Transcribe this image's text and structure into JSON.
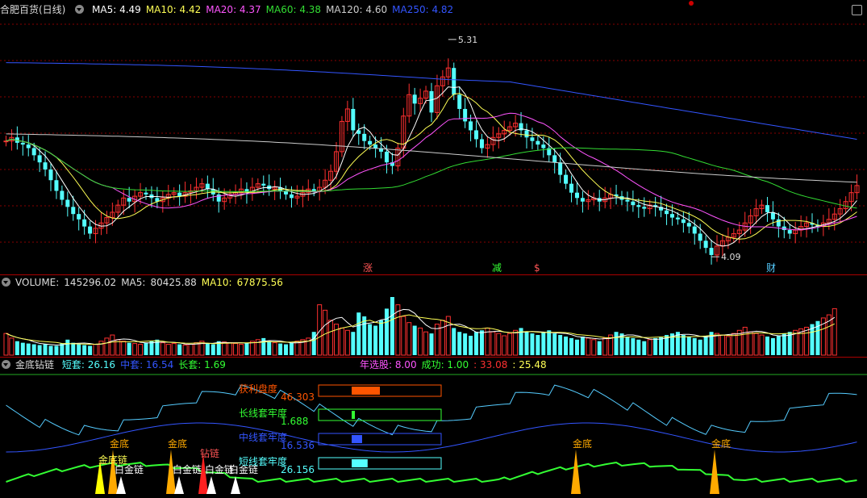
{
  "colors": {
    "up": "#ff3030",
    "down": "#54ffff",
    "ma5": "#ffffff",
    "ma10": "#ffff55",
    "ma20": "#ff55ff",
    "ma60": "#33dd33",
    "ma120": "#cccccc",
    "ma250": "#3355ff",
    "grid": "#880000",
    "bg": "#000000"
  },
  "main_panel": {
    "title": "合肥百货(日线)",
    "ma": [
      {
        "label": "MA5:",
        "value": "4.49",
        "color": "#ffffff"
      },
      {
        "label": "MA10:",
        "value": "4.42",
        "color": "#ffff55"
      },
      {
        "label": "MA20:",
        "value": "4.37",
        "color": "#ff55ff"
      },
      {
        "label": "MA60:",
        "value": "4.38",
        "color": "#33dd33"
      },
      {
        "label": "MA120:",
        "value": "4.60",
        "color": "#cccccc"
      },
      {
        "label": "MA250:",
        "value": "4.82",
        "color": "#3355ff"
      }
    ],
    "high_label": "5.31",
    "low_label": "4.09",
    "markers": [
      {
        "text": "涨",
        "color": "#ff5555"
      },
      {
        "text": "减",
        "color": "#33ff33"
      },
      {
        "text": "$",
        "color": "#ff5555"
      },
      {
        "text": "财",
        "color": "#55ccff"
      }
    ]
  },
  "volume_panel": {
    "label": "VOLUME:",
    "value": "145296.02",
    "ma5_label": "MA5:",
    "ma5_value": "80425.88",
    "ma10_label": "MA10:",
    "ma10_value": "67875.56"
  },
  "indicator_panel": {
    "title": "金底钻链",
    "items": [
      {
        "label": "短套:",
        "value": "26.16",
        "color": "#55ffff"
      },
      {
        "label": "中套:",
        "value": "16.54",
        "color": "#3355ff"
      },
      {
        "label": "长套:",
        "value": "1.69",
        "color": "#33ff33"
      }
    ],
    "stats": [
      {
        "label": "年选股:",
        "value": "8.00",
        "color": "#ff55ff"
      },
      {
        "label": "成功:",
        "value": "1.00",
        "color": "#33ff33"
      },
      {
        "label": ":",
        "value": "33.08",
        "color": "#ff3030"
      },
      {
        "label": ":",
        "value": "25.48",
        "color": "#ffff55"
      }
    ],
    "bars": [
      {
        "label": "获利盘度",
        "value": "46.303",
        "color": "#ff5500",
        "fill": 0.46
      },
      {
        "label": "长线套牢度",
        "value": "1.688",
        "color": "#33ff33",
        "fill": 0.02
      },
      {
        "label": "中线套牢度",
        "value": "16.536",
        "color": "#3355ff",
        "fill": 0.17
      },
      {
        "label": "短线套牢度",
        "value": "26.156",
        "color": "#55ffff",
        "fill": 0.26
      }
    ],
    "signals": [
      "金底",
      "金底",
      "金底",
      "金底",
      "钻链",
      "金底链"
    ],
    "signal_small": [
      "白金链",
      "白金链",
      "白金链",
      "白金链"
    ]
  },
  "chart_data": {
    "type": "candlestick",
    "title": "合肥百货(日线)",
    "ylim": [
      4.0,
      5.45
    ],
    "y_high": 5.31,
    "y_low": 4.09,
    "closes": [
      4.74,
      4.76,
      4.73,
      4.72,
      4.7,
      4.66,
      4.62,
      4.58,
      4.52,
      4.46,
      4.41,
      4.37,
      4.33,
      4.3,
      4.26,
      4.22,
      4.25,
      4.28,
      4.31,
      4.34,
      4.38,
      4.42,
      4.4,
      4.43,
      4.45,
      4.44,
      4.42,
      4.4,
      4.42,
      4.44,
      4.45,
      4.43,
      4.45,
      4.46,
      4.48,
      4.5,
      4.47,
      4.44,
      4.4,
      4.42,
      4.44,
      4.45,
      4.47,
      4.45,
      4.48,
      4.5,
      4.49,
      4.47,
      4.48,
      4.46,
      4.44,
      4.42,
      4.43,
      4.45,
      4.47,
      4.46,
      4.48,
      4.52,
      4.57,
      4.68,
      4.85,
      4.92,
      4.8,
      4.78,
      4.74,
      4.72,
      4.7,
      4.68,
      4.62,
      4.6,
      4.7,
      4.88,
      5.0,
      4.95,
      4.98,
      5.02,
      4.9,
      5.05,
      5.1,
      5.15,
      5.0,
      4.92,
      4.85,
      4.8,
      4.75,
      4.7,
      4.72,
      4.76,
      4.78,
      4.8,
      4.82,
      4.84,
      4.8,
      4.76,
      4.74,
      4.72,
      4.7,
      4.66,
      4.62,
      4.55,
      4.5,
      4.45,
      4.42,
      4.4,
      4.41,
      4.42,
      4.4,
      4.42,
      4.44,
      4.43,
      4.41,
      4.4,
      4.38,
      4.37,
      4.36,
      4.38,
      4.37,
      4.35,
      4.33,
      4.31,
      4.3,
      4.28,
      4.26,
      4.22,
      4.18,
      4.14,
      4.1,
      4.15,
      4.18,
      4.2,
      4.22,
      4.24,
      4.28,
      4.32,
      4.36,
      4.38,
      4.34,
      4.3,
      4.26,
      4.24,
      4.22,
      4.24,
      4.26,
      4.28,
      4.27,
      4.26,
      4.28,
      4.3,
      4.33,
      4.36,
      4.4,
      4.45,
      4.49
    ],
    "volume": [
      28,
      22,
      18,
      16,
      15,
      14,
      13,
      14,
      12,
      12,
      15,
      20,
      16,
      14,
      13,
      12,
      14,
      18,
      22,
      26,
      20,
      18,
      16,
      15,
      14,
      16,
      18,
      20,
      16,
      14,
      15,
      14,
      13,
      14,
      16,
      18,
      15,
      14,
      18,
      17,
      16,
      15,
      14,
      16,
      18,
      20,
      22,
      18,
      16,
      15,
      14,
      16,
      18,
      20,
      22,
      30,
      65,
      58,
      45,
      40,
      35,
      32,
      30,
      55,
      50,
      40,
      38,
      45,
      60,
      75,
      65,
      50,
      42,
      38,
      35,
      30,
      28,
      40,
      45,
      50,
      35,
      30,
      28,
      25,
      30,
      32,
      35,
      30,
      28,
      25,
      28,
      32,
      35,
      30,
      28,
      26,
      30,
      32,
      28,
      26,
      24,
      22,
      20,
      24,
      22,
      20,
      18,
      22,
      26,
      30,
      28,
      24,
      22,
      20,
      18,
      20,
      22,
      24,
      26,
      28,
      30,
      26,
      24,
      22,
      20,
      25,
      30,
      28,
      26,
      24,
      28,
      32,
      36,
      30,
      28,
      26,
      24,
      22,
      25,
      28,
      30,
      32,
      34,
      36,
      40,
      44,
      48,
      52,
      60
    ],
    "vol_ma5_value": 80425.88,
    "vol_ma10_value": 67875.56
  }
}
